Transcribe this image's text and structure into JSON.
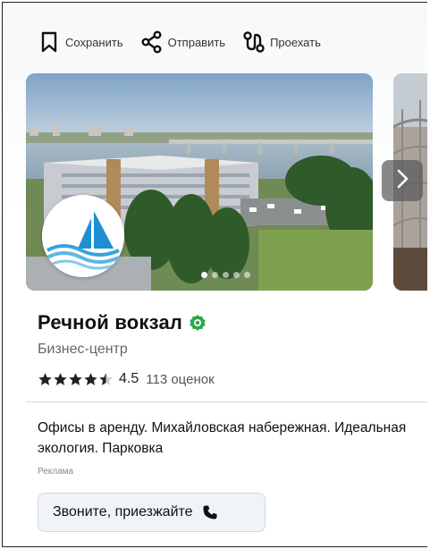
{
  "actions": {
    "save_label": "Сохранить",
    "share_label": "Отправить",
    "route_label": "Проехать"
  },
  "gallery": {
    "slides_total": 5,
    "active_slide": 1
  },
  "business": {
    "name": "Речной вокзал",
    "verified": true,
    "category": "Бизнес-центр",
    "rating_value": "4.5",
    "rating_stars": 4.5,
    "reviews_count": "113 оценок"
  },
  "ad": {
    "text": "Офисы в аренду. Михайловская набережная. Идеальная экология. Парковка",
    "label": "Реклама",
    "cta_label": "Звоните, приезжайте"
  },
  "colors": {
    "verified": "#2ba84a",
    "stars": "#222222",
    "logo_blue": "#1f8fd0"
  },
  "icons": {
    "save": "bookmark-icon",
    "share": "share-icon",
    "route": "route-icon",
    "next": "chevron-right-icon",
    "verified": "verified-badge-icon",
    "call": "phone-icon"
  }
}
